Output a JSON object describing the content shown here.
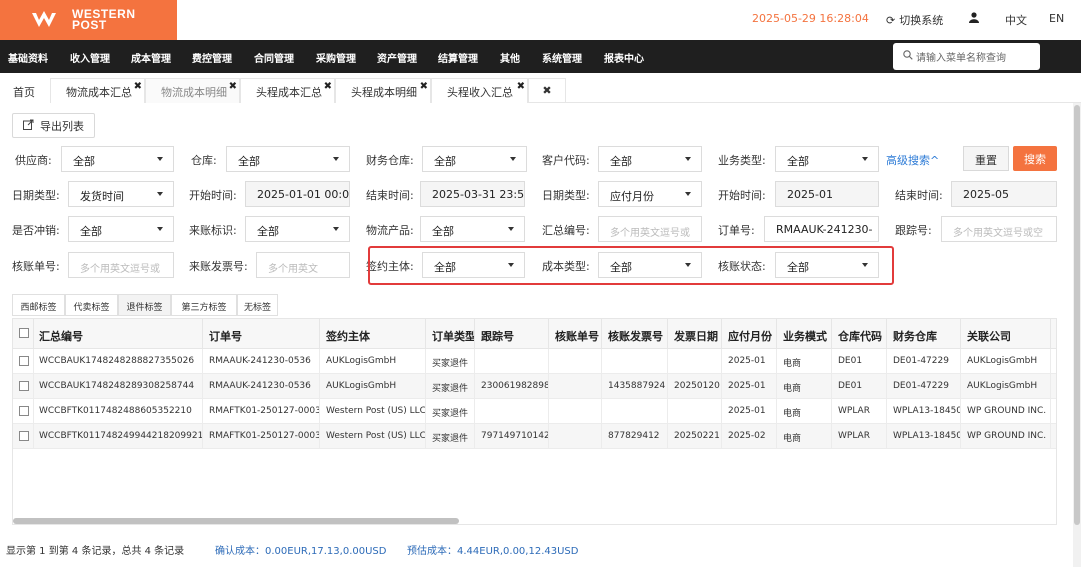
{
  "brand": {
    "line1": "WESTERN",
    "line2": "POST",
    "color": "#f4733f"
  },
  "header": {
    "datetime": "2025-05-29 16:28:04",
    "switch_system": "切换系统",
    "lang_zh": "中文",
    "lang_en": "EN"
  },
  "nav": {
    "items": [
      "基础资料",
      "收入管理",
      "成本管理",
      "费控管理",
      "合同管理",
      "采购管理",
      "资产管理",
      "结算管理",
      "其他",
      "系统管理",
      "报表中心"
    ],
    "search_placeholder": "请输入菜单名称查询"
  },
  "tabs": [
    "首页",
    "物流成本汇总",
    "物流成本明细",
    "头程成本汇总",
    "头程成本明细",
    "头程收入汇总"
  ],
  "export_label": "导出列表",
  "filters": {
    "supplier_label": "供应商:",
    "supplier_value": "全部",
    "warehouse_label": "仓库:",
    "warehouse_value": "全部",
    "fin_warehouse_label": "财务仓库:",
    "fin_warehouse_value": "全部",
    "customer_code_label": "客户代码:",
    "customer_code_value": "全部",
    "biz_type_label": "业务类型:",
    "biz_type_value": "全部",
    "advanced": "高级搜索^",
    "reset": "重置",
    "search": "搜索",
    "date_type1_label": "日期类型:",
    "date_type1_value": "发货时间",
    "start_time1_label": "开始时间:",
    "start_time1_value": "2025-01-01 00:0",
    "end_time1_label": "结束时间:",
    "end_time1_value": "2025-03-31 23:5",
    "date_type2_label": "日期类型:",
    "date_type2_value": "应付月份",
    "start_time2_label": "开始时间:",
    "start_time2_value": "2025-01",
    "end_time2_label": "结束时间:",
    "end_time2_value": "2025-05",
    "offset_label": "是否冲销:",
    "offset_value": "全部",
    "bill_flag_label": "来账标识:",
    "bill_flag_value": "全部",
    "product_label": "物流产品:",
    "product_value": "全部",
    "summary_no_label": "汇总编号:",
    "summary_no_ph": "多个用英文逗号或",
    "order_no_label": "订单号:",
    "order_no_value": "RMAAUK-241230-",
    "tracking_label": "跟踪号:",
    "tracking_ph": "多个用英文逗号或空",
    "verify_no_label": "核账单号:",
    "verify_no_ph": "多个用英文逗号或",
    "invoice_no_label": "来账发票号:",
    "invoice_no_ph": "多个用英文",
    "contract_subject_label": "签约主体:",
    "contract_subject_value": "全部",
    "cost_type_label": "成本类型:",
    "cost_type_value": "全部",
    "verify_status_label": "核账状态:",
    "verify_status_value": "全部"
  },
  "subtabs": [
    "西邮标签",
    "代卖标签",
    "退件标签",
    "第三方标签",
    "无标签"
  ],
  "table": {
    "headers": [
      "汇总编号",
      "订单号",
      "签约主体",
      "订单类型",
      "跟踪号",
      "核账单号",
      "核账发票号",
      "发票日期",
      "应付月份",
      "业务模式",
      "仓库代码",
      "财务仓库",
      "关联公司"
    ],
    "rows": [
      [
        "WCCBAUK1748248288827355026",
        "RMAAUK-241230-0536",
        "AUKLogisGmbH",
        "买家退件",
        "",
        "",
        "",
        "",
        "2025-01",
        "电商",
        "DE01",
        "DE01-47229",
        "AUKLogisGmbH"
      ],
      [
        "WCCBAUK1748248289308258744",
        "RMAAUK-241230-0536",
        "AUKLogisGmbH",
        "买家退件",
        "230061982898",
        "",
        "1435887924",
        "20250120",
        "2025-01",
        "电商",
        "DE01",
        "DE01-47229",
        "AUKLogisGmbH"
      ],
      [
        "WCCBFTK0117482488605352210",
        "RMAFTK01-250127-0003",
        "Western Post (US) LLC",
        "买家退件",
        "",
        "",
        "",
        "",
        "2025-01",
        "电商",
        "WPLAR",
        "WPLA13-18450",
        "WP GROUND INC."
      ],
      [
        "WCCBFTK0117482499442182099​21",
        "RMAFTK01-250127-0003",
        "Western Post (US) LLC",
        "买家退件",
        "797149710142",
        "",
        "877829412",
        "20250221",
        "2025-02",
        "电商",
        "WPLAR",
        "WPLA13-18450",
        "WP GROUND INC."
      ]
    ]
  },
  "footer": {
    "info": "显示第 1 到第 4 条记录，总共 4 条记录",
    "confirmed_cost": "确认成本：0.00EUR,17.13,0.00USD",
    "estimated_cost": "预估成本：4.44EUR,0.00,12.43USD"
  }
}
